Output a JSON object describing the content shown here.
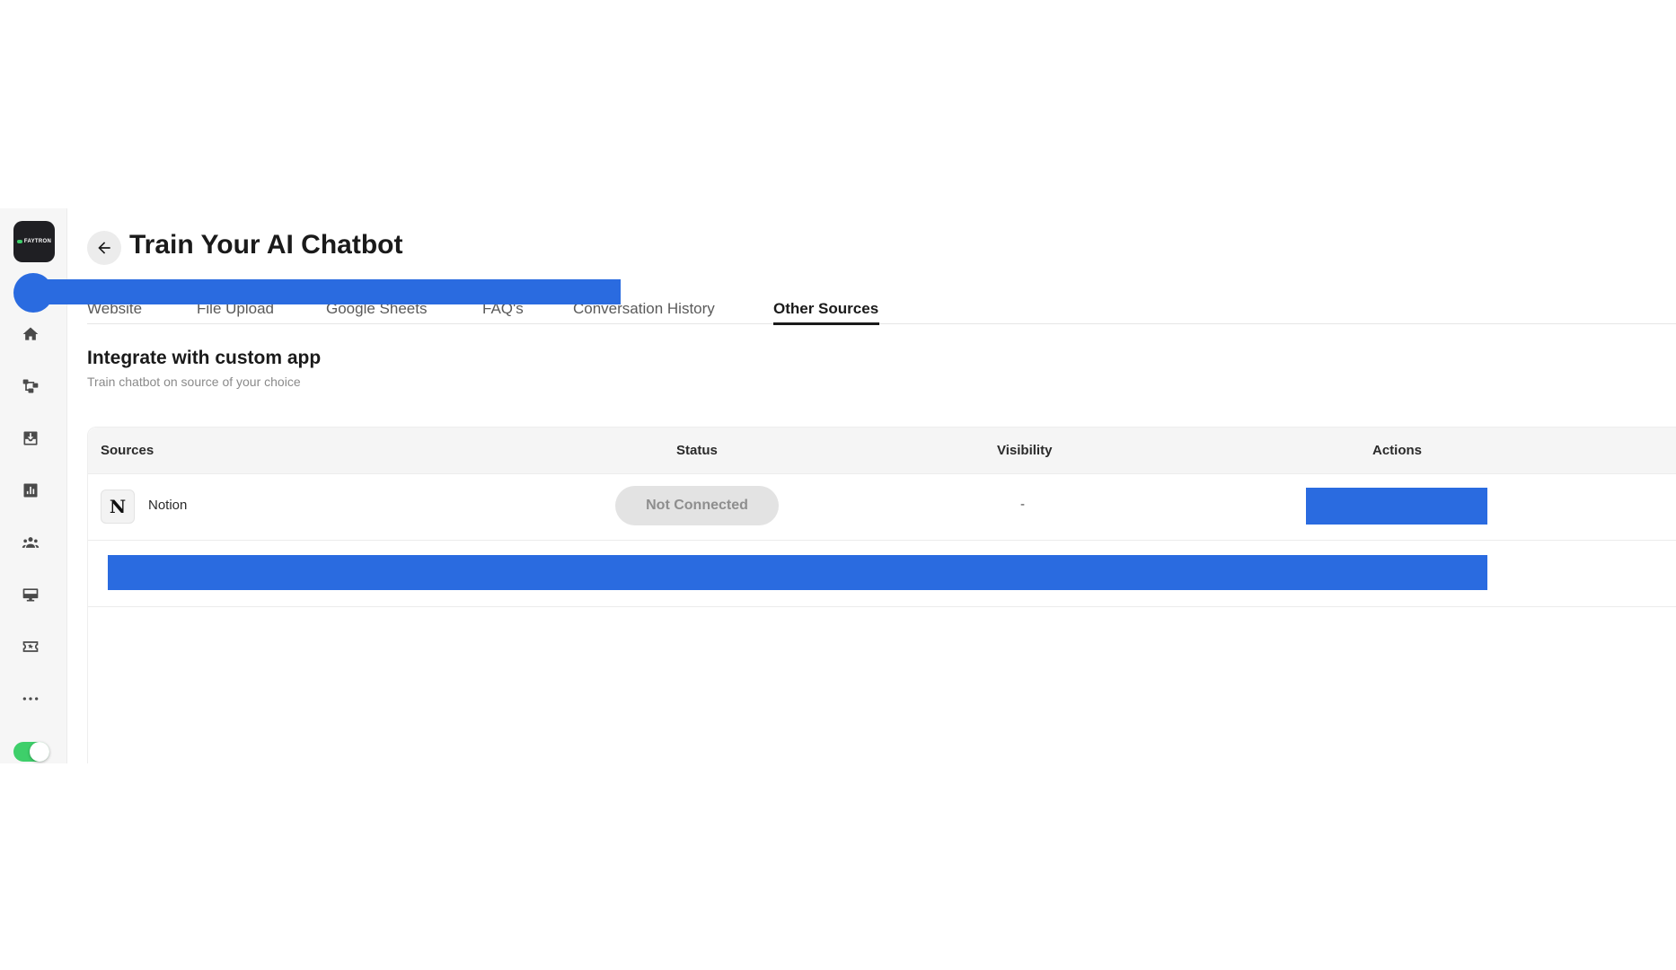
{
  "sidebar": {
    "logo_text": "FAYTRON",
    "items": [
      {
        "name": "home-icon"
      },
      {
        "name": "flow-icon"
      },
      {
        "name": "inbox-icon"
      },
      {
        "name": "analytics-icon"
      },
      {
        "name": "team-icon"
      },
      {
        "name": "monitor-icon"
      },
      {
        "name": "ticket-icon"
      },
      {
        "name": "more-icon"
      }
    ],
    "toggle_on": true
  },
  "header": {
    "title": "Train Your AI Chatbot"
  },
  "tabs": [
    {
      "label": "Website",
      "active": false
    },
    {
      "label": "File Upload",
      "active": false
    },
    {
      "label": "Google Sheets",
      "active": false
    },
    {
      "label": "FAQ's",
      "active": false
    },
    {
      "label": "Conversation History",
      "active": false
    },
    {
      "label": "Other Sources",
      "active": true
    }
  ],
  "section": {
    "title": "Integrate with custom app",
    "subtitle": "Train chatbot on source of your choice"
  },
  "table": {
    "columns": [
      "Sources",
      "Status",
      "Visibility",
      "Actions"
    ],
    "rows": [
      {
        "source": "Notion",
        "icon_letter": "N",
        "status": "Not Connected",
        "visibility": "-"
      }
    ]
  },
  "colors": {
    "redaction": "#2a6be0",
    "toggle": "#3ecf6a"
  }
}
